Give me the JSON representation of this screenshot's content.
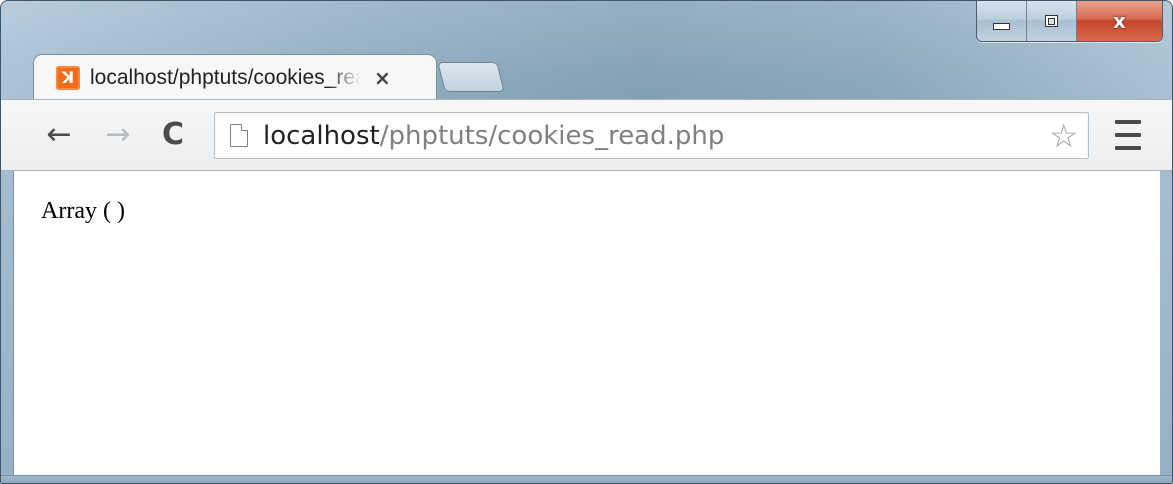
{
  "window": {
    "controls": {
      "minimize_icon": "minimize-icon",
      "maximize_icon": "maximize-icon",
      "close_glyph": "x",
      "close_color": "#c7452b"
    }
  },
  "tabs": [
    {
      "title": "localhost/phptuts/cookies_read.php",
      "favicon": "xampp-icon",
      "favicon_glyph": "ꓘ",
      "favicon_color": "#f06c1a",
      "close_glyph": "×"
    }
  ],
  "toolbar": {
    "back_glyph": "←",
    "forward_glyph": "→",
    "reload_glyph": "C",
    "omnibox": {
      "host": "localhost",
      "path": "/phptuts/cookies_read.php",
      "bookmark_glyph": "☆"
    }
  },
  "page": {
    "body_text": "Array ( )"
  }
}
